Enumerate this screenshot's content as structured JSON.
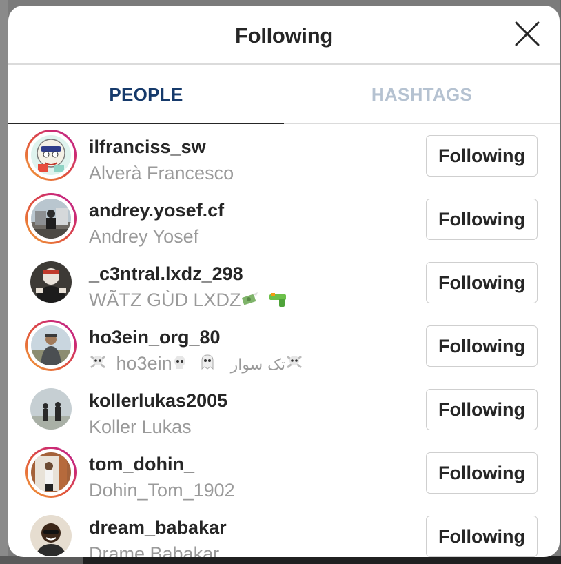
{
  "header": {
    "title": "Following",
    "close_icon": "close-icon"
  },
  "tabs": [
    {
      "label": "PEOPLE",
      "active": true,
      "color": "#163a6b"
    },
    {
      "label": "HASHTAGS",
      "active": false,
      "color": "#b5c2d1"
    }
  ],
  "users": [
    {
      "username": "ilfranciss_sw",
      "full_name": "Alverà Francesco",
      "button": "Following",
      "story_ring": true
    },
    {
      "username": "andrey.yosef.cf",
      "full_name": "Andrey Yosef",
      "button": "Following",
      "story_ring": true
    },
    {
      "username": "_c3ntral.lxdz_298",
      "full_name": "WÃTZ GÙD LXDZ",
      "full_name_icons": [
        "money-with-wings-icon",
        "water-pistol-icon"
      ],
      "button": "Following",
      "story_ring": false
    },
    {
      "username": "ho3ein_org_80",
      "full_name_parts": [
        "ho3ein",
        "تک سوار"
      ],
      "full_name_icons": [
        "skull-crossbones-icon",
        "skull-icon",
        "ghost-icon",
        "skull-crossbones-icon"
      ],
      "button": "Following",
      "story_ring": true
    },
    {
      "username": "kollerlukas2005",
      "full_name": "Koller Lukas",
      "button": "Following",
      "story_ring": false
    },
    {
      "username": "tom_dohin_",
      "full_name": "Dohin_Tom_1902",
      "button": "Following",
      "story_ring": true
    },
    {
      "username": "dream_babakar",
      "full_name": "Drame Babakar",
      "button": "Following",
      "story_ring": false
    }
  ],
  "colors": {
    "ring_gradient": [
      "#f3a23a",
      "#e0533c",
      "#cc2a73",
      "#bc2d8f"
    ],
    "text_primary": "#262626",
    "text_secondary": "#9a9a9a"
  }
}
